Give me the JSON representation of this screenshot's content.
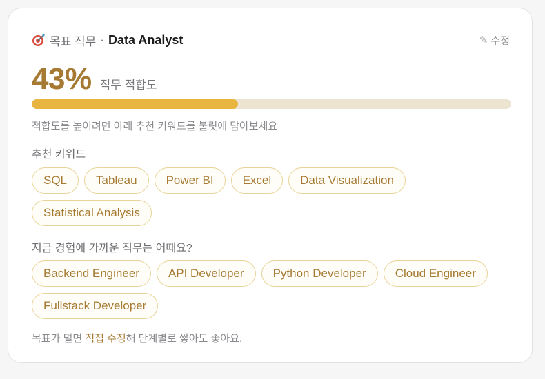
{
  "header": {
    "label": "목표 직무",
    "separator": "·",
    "job_title": "Data Analyst",
    "edit_label": "수정"
  },
  "score": {
    "value": "43%",
    "label": "직무 적합도",
    "progress_fraction": 0.43
  },
  "hint": "적합도를 높이려면 아래 추천 키워드를 불릿에 담아보세요",
  "keywords": {
    "label": "추천 키워드",
    "items": [
      "SQL",
      "Tableau",
      "Power BI",
      "Excel",
      "Data Visualization",
      "Statistical Analysis"
    ]
  },
  "similar_roles": {
    "label": "지금 경험에 가까운 직무는 어때요?",
    "items": [
      "Backend Engineer",
      "API Developer",
      "Python Developer",
      "Cloud Engineer",
      "Fullstack Developer"
    ]
  },
  "footer": {
    "prefix": "목표가 멀면 ",
    "link": "직접 수정",
    "suffix": "해 단계별로 쌓아도 좋아요."
  },
  "colors": {
    "accent": "#a67a32",
    "progress_fill": "#e8b540",
    "progress_track": "#ece4d0",
    "chip_border": "#e8d49a"
  },
  "icons": {
    "title": "target-dart-icon",
    "edit": "pencil-icon"
  }
}
